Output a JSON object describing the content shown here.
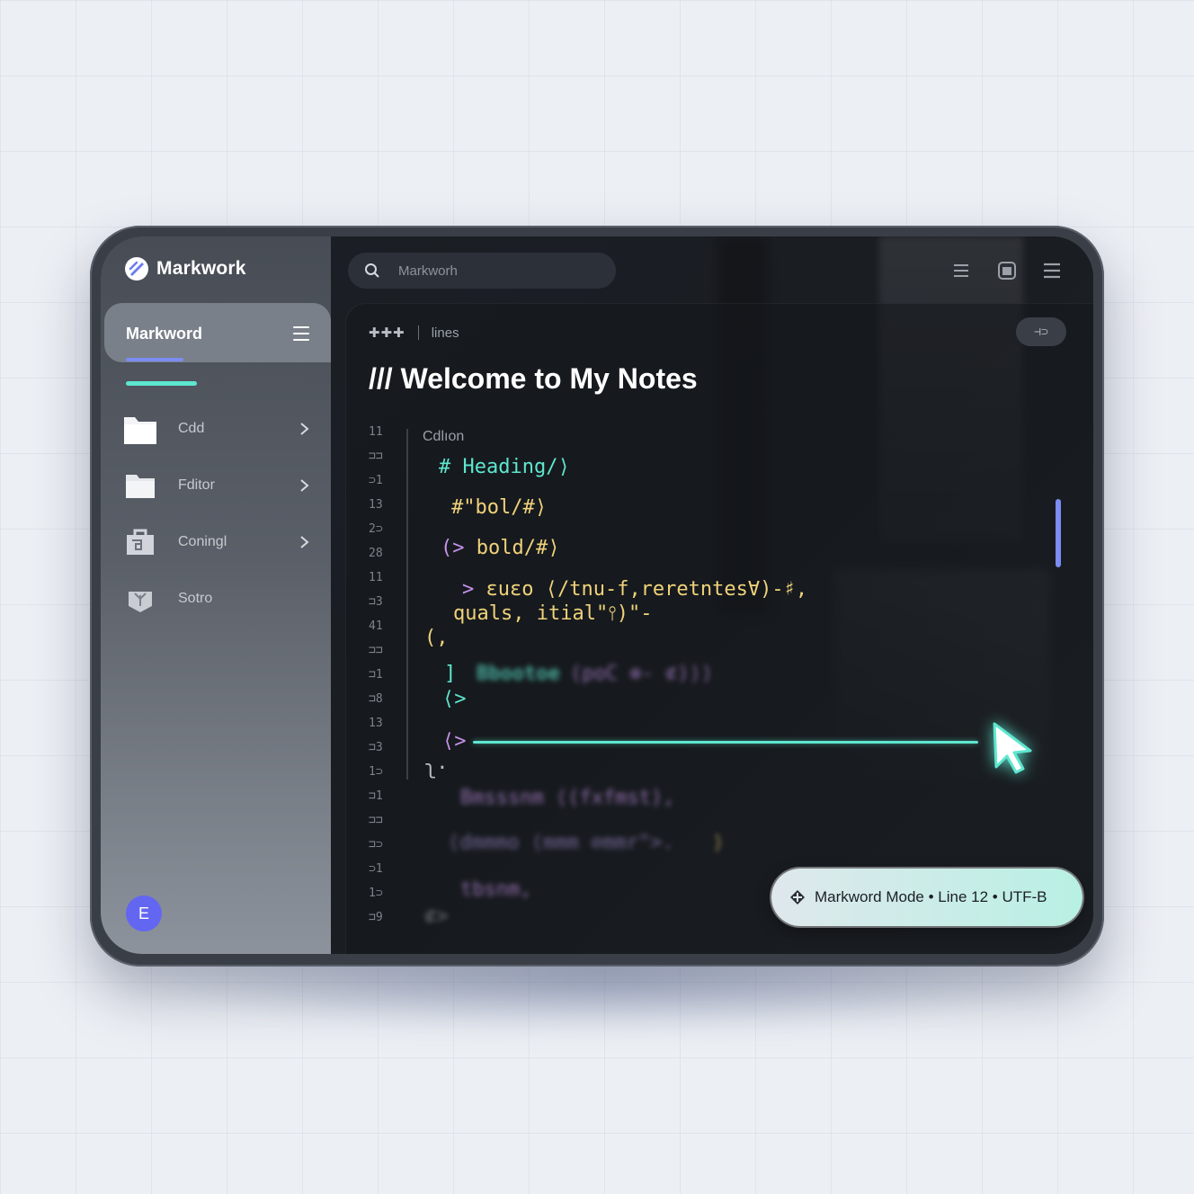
{
  "app": {
    "name": "Markwork"
  },
  "sidebar": {
    "header_label": "Markword",
    "items": [
      {
        "label": "Cdd",
        "has_chevron": true
      },
      {
        "label": "Fditor",
        "has_chevron": true
      },
      {
        "label": "Coningl",
        "has_chevron": true
      },
      {
        "label": "Sotro",
        "has_chevron": false
      }
    ],
    "avatar_initial": "E"
  },
  "search": {
    "placeholder": "Markworh"
  },
  "editor": {
    "toolbar_symbols": "✚✚✚",
    "toolbar_label": "lines",
    "toggle_label": "⊣⊃",
    "title": "/// Welcome to My Notes",
    "gutter": [
      "11",
      "⊐⊐",
      "⊃1",
      "13",
      "2⊃",
      "28",
      "11",
      "⊐3",
      "41",
      "⊐⊐",
      "⊐1",
      "⊐8",
      "13",
      "⊐3",
      "1⊃",
      "⊐1",
      "⊐⊐",
      "⊐⊃",
      "⊃1",
      "1⊃",
      "⊐9"
    ],
    "first_line_label": "Cdlıon",
    "code": {
      "line1": "# Heading/⟩",
      "line2": "#\"bol/#⟩",
      "line3_a": "(>",
      "line3_b": " bold/#⟩",
      "line4_a": "> ",
      "line4_b": "ɛuɛo ⟨/tnu-f,reretntes∀)-♯,",
      "line5": "quals, itial\"⫯)\"-",
      "line6": "(,",
      "line7_a": "]",
      "line7_b": "Bbootoe",
      "line7_c": " (poC ⊕- ⊄)⟩⟩",
      "line8": "⟨>",
      "line9": "⟨>",
      "line10": "ʅ·",
      "line11": "Bmsssnm ⟨(fxfmst),",
      "line12": "⟨dmmmo ⟨mmm ⊘mmr\">.",
      "line12_b": "⟩",
      "line13": "tbsnm,",
      "line14": "⊄>"
    }
  },
  "status": {
    "text": "Markword Mode • Line 12 • UTF-B"
  },
  "colors": {
    "accent_cyan": "#5ee6cf",
    "accent_indigo": "#7b8cf2",
    "avatar": "#6366f1",
    "code_yellow": "#f0d27a",
    "code_purple": "#c792ea"
  },
  "icons": [
    "markwork-logo-icon",
    "search-icon",
    "list-icon",
    "window-icon",
    "menu-icon",
    "folder-icon",
    "file-icon",
    "bag-icon",
    "plant-icon",
    "chevron-right-icon",
    "pointer-icon",
    "plus-diamond-icon"
  ]
}
